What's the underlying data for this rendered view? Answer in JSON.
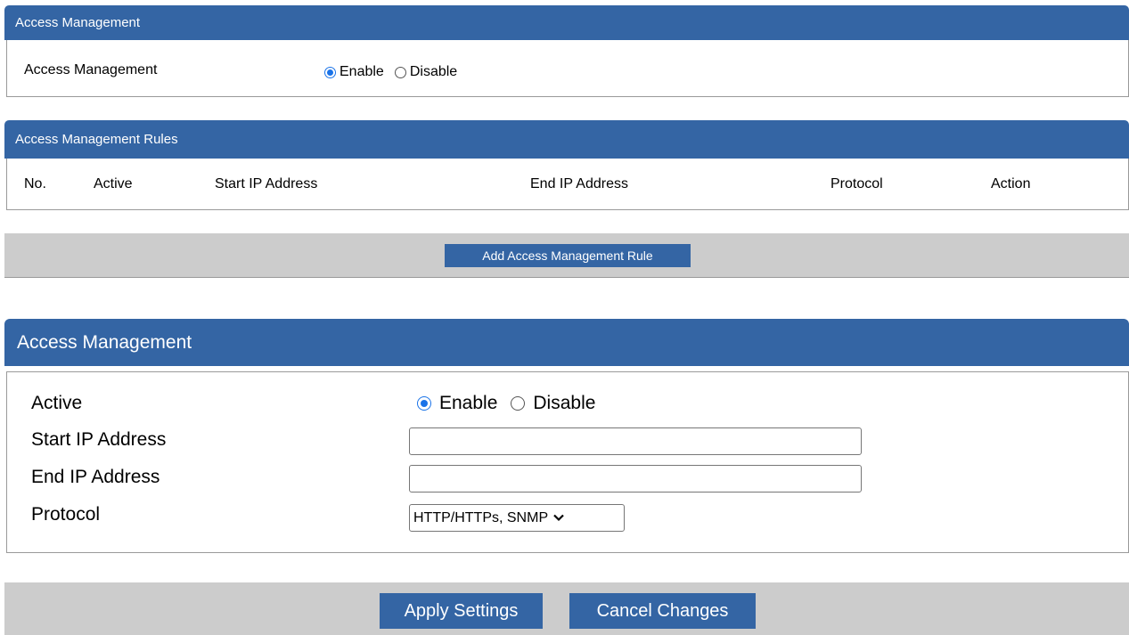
{
  "section1": {
    "header": "Access Management",
    "label": "Access Management",
    "enable_label": "Enable",
    "disable_label": "Disable",
    "selected": "Enable"
  },
  "rules": {
    "header": "Access Management Rules",
    "columns": [
      "No.",
      "Active",
      "Start IP Address",
      "End IP Address",
      "Protocol",
      "Action"
    ],
    "add_button": "Add Access Management Rule"
  },
  "form": {
    "header": "Access Management",
    "active_label": "Active",
    "enable_label": "Enable",
    "disable_label": "Disable",
    "selected": "Enable",
    "start_ip_label": "Start IP Address",
    "start_ip_value": "",
    "end_ip_label": "End IP Address",
    "end_ip_value": "",
    "protocol_label": "Protocol",
    "protocol_value": "HTTP/HTTPs, SNMP"
  },
  "footer": {
    "apply_button": "Apply Settings",
    "cancel_button": "Cancel Changes"
  },
  "colors": {
    "header_blue": "#3465a4",
    "button_blue": "#3465a4",
    "gray_bar": "#cccccc",
    "radio_accent": "#1a73e8"
  },
  "icons": [
    "radio-checked-icon",
    "radio-unchecked-icon",
    "chevron-down-icon"
  ]
}
